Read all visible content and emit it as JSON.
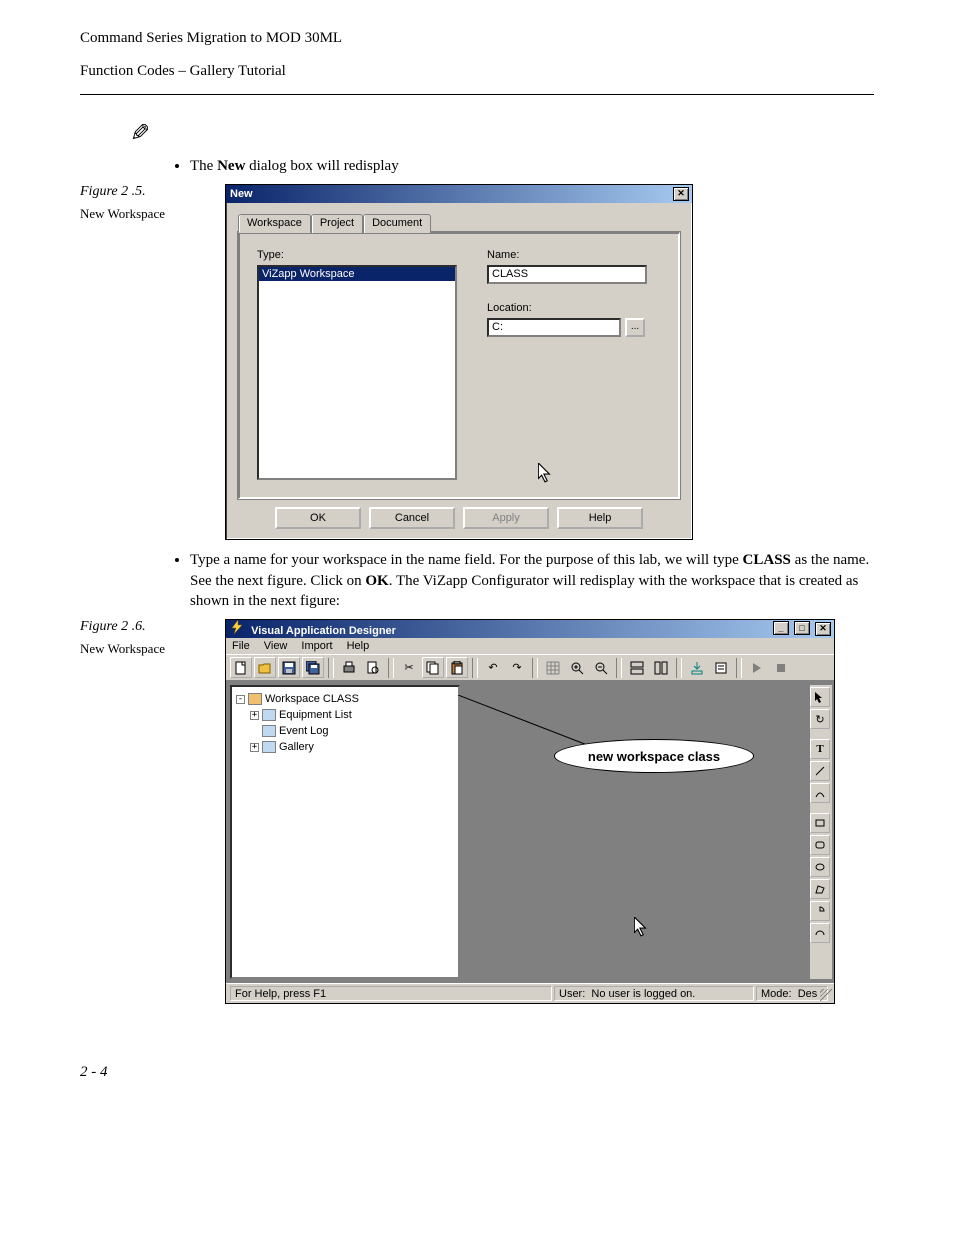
{
  "doc_header": {
    "title": "Command Series Migration to MOD 30ML",
    "subtitle": "Function Codes – Gallery Tutorial"
  },
  "bullets": {
    "item1_prefix": "The ",
    "item1_bold": "New",
    "item1_suffix": " dialog box will redisplay",
    "item2_part1": "Type a name for your workspace in the name field. For the purpose of this lab, we will type ",
    "item2_bold1": "CLASS",
    "item2_part2": " as the name. See the next figure. Click on ",
    "item2_bold2": "OK",
    "item2_part3": ". The ViZapp Configurator will redisplay with the workspace that is created as shown in the next figure:"
  },
  "figures": {
    "f25_num": "Figure 2 .5.",
    "f25_cap": "New Workspace",
    "f26_num": "Figure 2 .6.",
    "f26_cap": "New Workspace"
  },
  "dlg_new": {
    "title": "New",
    "tabs": {
      "workspace": "Workspace",
      "project": "Project",
      "document": "Document"
    },
    "type_label": "Type:",
    "type_item": "ViZapp Workspace",
    "name_label": "Name:",
    "name_value": "CLASS",
    "location_label": "Location:",
    "location_value": "C:",
    "browse_label": "...",
    "buttons": {
      "ok": "OK",
      "cancel": "Cancel",
      "apply": "Apply",
      "help": "Help"
    }
  },
  "vad": {
    "title": "Visual Application Designer",
    "menus": {
      "file": "File",
      "view": "View",
      "import": "Import",
      "help": "Help"
    },
    "tree": {
      "root": "Workspace CLASS",
      "n1": "Equipment List",
      "n2": "Event Log",
      "n3": "Gallery"
    },
    "callout": "new workspace class",
    "status": {
      "help": "For Help, press F1",
      "user_label": "User:",
      "user_value": "No user is logged on.",
      "mode_label": "Mode:",
      "mode_value": "Des"
    }
  },
  "page_number": "2 - 4"
}
